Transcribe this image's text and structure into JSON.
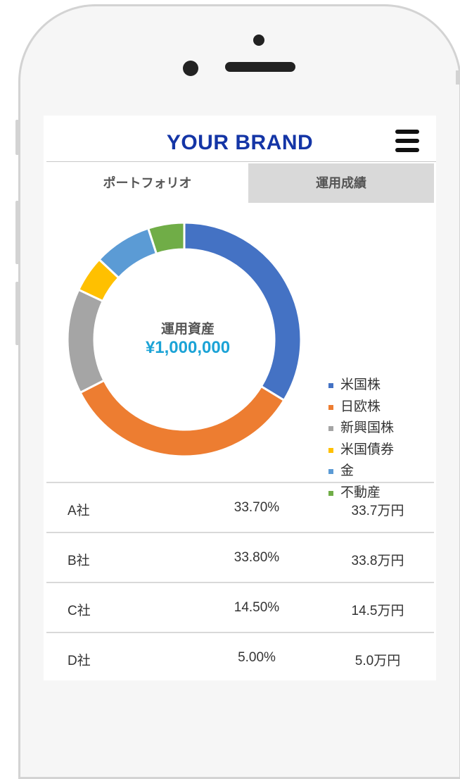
{
  "header": {
    "brand": "YOUR BRAND"
  },
  "tabs": [
    {
      "label": "ポートフォリオ",
      "active": true
    },
    {
      "label": "運用成績",
      "active": false
    }
  ],
  "summary": {
    "label": "運用資産",
    "value": "¥1,000,000"
  },
  "chart_data": {
    "type": "pie",
    "subtype": "donut",
    "series": [
      {
        "name": "米国株",
        "value": 33.7,
        "color": "#4472c4"
      },
      {
        "name": "日欧株",
        "value": 33.8,
        "color": "#ed7d31"
      },
      {
        "name": "新興国株",
        "value": 14.5,
        "color": "#a5a5a5"
      },
      {
        "name": "米国債券",
        "value": 5.0,
        "color": "#ffc000"
      },
      {
        "name": "金",
        "value": 8.0,
        "color": "#5b9bd5"
      },
      {
        "name": "不動産",
        "value": 5.0,
        "color": "#70ad47"
      }
    ],
    "legend_position": "right"
  },
  "table": {
    "rows": [
      {
        "name": "A社",
        "pct": "33.70%",
        "amount": "33.7万円"
      },
      {
        "name": "B社",
        "pct": "33.80%",
        "amount": "33.8万円"
      },
      {
        "name": "C社",
        "pct": "14.50%",
        "amount": "14.5万円"
      },
      {
        "name": "D社",
        "pct": "5.00%",
        "amount": "5.0万円"
      }
    ]
  }
}
